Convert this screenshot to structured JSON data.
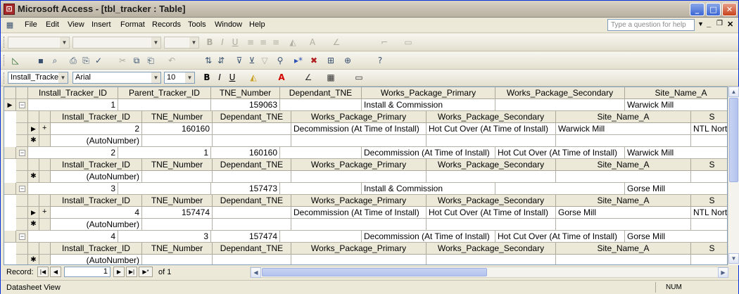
{
  "window": {
    "title": "Microsoft Access - [tbl_tracker : Table]"
  },
  "menu": [
    "File",
    "Edit",
    "View",
    "Insert",
    "Format",
    "Records",
    "Tools",
    "Window",
    "Help"
  ],
  "help_placeholder": "Type a question for help",
  "format_bar": {
    "object_combo": "Install_Tracker_",
    "font": "Arial",
    "size": "10"
  },
  "main_headers": [
    "Install_Tracker_ID",
    "Parent_Tracker_ID",
    "TNE_Number",
    "Dependant_TNE",
    "Works_Package_Primary",
    "Works_Package_Secondary",
    "Site_Name_A"
  ],
  "sub_headers": [
    "Install_Tracker_ID",
    "TNE_Number",
    "Dependant_TNE",
    "Works_Package_Primary",
    "Works_Package_Secondary",
    "Site_Name_A",
    "S"
  ],
  "records": [
    {
      "id": "1",
      "parent": "",
      "tne": "159063",
      "dep": "",
      "wpp": "Install & Commission",
      "wps": "",
      "site": "Warwick Mill",
      "sub": [
        {
          "id": "2",
          "tne": "160160",
          "dep": "",
          "wpp": "Decommission (At Time of Install)",
          "wps": "Hot Cut Over (At Time of Install)",
          "site": "Warwick Mill",
          "s": "NTL Nort"
        }
      ]
    },
    {
      "id": "2",
      "parent": "1",
      "tne": "160160",
      "dep": "",
      "wpp": "Decommission (At Time of Install)",
      "wps": "Hot Cut Over (At Time of Install)",
      "site": "Warwick Mill",
      "sub": []
    },
    {
      "id": "3",
      "parent": "",
      "tne": "157473",
      "dep": "",
      "wpp": "Install & Commission",
      "wps": "",
      "site": "Gorse Mill",
      "sub": [
        {
          "id": "4",
          "tne": "157474",
          "dep": "",
          "wpp": "Decommission (At Time of Install)",
          "wps": "Hot Cut Over (At Time of Install)",
          "site": "Gorse Mill",
          "s": "NTL Nort"
        }
      ]
    },
    {
      "id": "4",
      "parent": "3",
      "tne": "157474",
      "dep": "",
      "wpp": "Decommission (At Time of Install)",
      "wps": "Hot Cut Over (At Time of Install)",
      "site": "Gorse Mill",
      "sub": []
    }
  ],
  "autonumber": "(AutoNumber)",
  "nav": {
    "label": "Record:",
    "current": "1",
    "of_text": "of 1"
  },
  "status": {
    "left": "Datasheet View",
    "right": "NUM"
  }
}
